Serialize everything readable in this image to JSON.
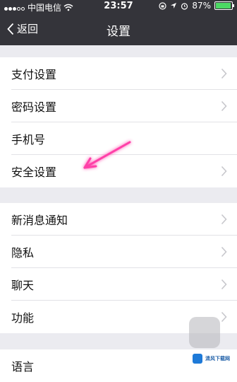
{
  "status": {
    "carrier": "中国电信",
    "time": "23:57",
    "battery_percent": "87%",
    "battery_level": 0.87,
    "icons": [
      "signal-dots-icon",
      "wifi-icon",
      "lock-rotation-icon",
      "location-icon",
      "alarm-icon",
      "battery-icon"
    ]
  },
  "nav": {
    "back_label": "返回",
    "title": "设置"
  },
  "groups": [
    {
      "items": [
        "支付设置",
        "密码设置",
        "手机号",
        "安全设置"
      ]
    },
    {
      "items": [
        "新消息通知",
        "隐私",
        "聊天",
        "功能"
      ]
    },
    {
      "items": [
        "语言"
      ]
    }
  ],
  "annotation": {
    "arrow_color": "#ff3fa8"
  },
  "watermark": {
    "text": "清风下载网"
  },
  "colors": {
    "topbar": "#34343a",
    "background": "#ebebf0"
  }
}
